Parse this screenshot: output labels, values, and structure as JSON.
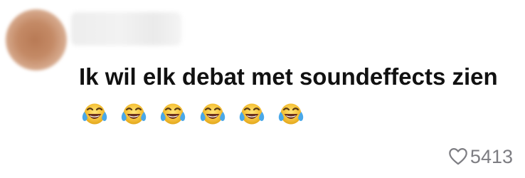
{
  "comment": {
    "text": "Ik wil elk debat met soundeffects zien",
    "emoji": [
      "face-with-tears-of-joy-icon",
      "face-with-tears-of-joy-icon",
      "face-with-tears-of-joy-icon",
      "face-with-tears-of-joy-icon",
      "face-with-tears-of-joy-icon",
      "face-with-tears-of-joy-icon"
    ]
  },
  "likes": {
    "count": "5413",
    "icon": "heart-outline-icon"
  },
  "colors": {
    "text": "#111111",
    "muted": "#7d7d82",
    "emoji_yellow": "#f6c43b",
    "tear_blue": "#4aa8e8"
  }
}
